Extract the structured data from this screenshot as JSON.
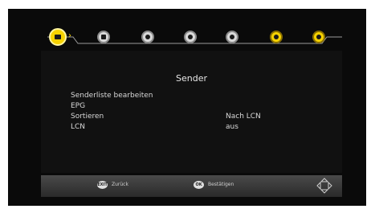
{
  "menu": {
    "icons": [
      "channel-list-icon",
      "picture-icon",
      "search-icon",
      "timer-icon",
      "globe-icon",
      "settings-icon",
      "satellite-icon"
    ]
  },
  "panel": {
    "title": "Sender",
    "items": [
      {
        "label": "Senderliste bearbeiten",
        "value": ""
      },
      {
        "label": "EPG",
        "value": ""
      },
      {
        "label": "Sortieren",
        "value": "Nach LCN"
      },
      {
        "label": "LCN",
        "value": "aus"
      }
    ]
  },
  "footer": {
    "back_key": "EXIT",
    "back_label": "Zurück",
    "ok_key": "OK",
    "ok_label": "Bestätigen"
  }
}
